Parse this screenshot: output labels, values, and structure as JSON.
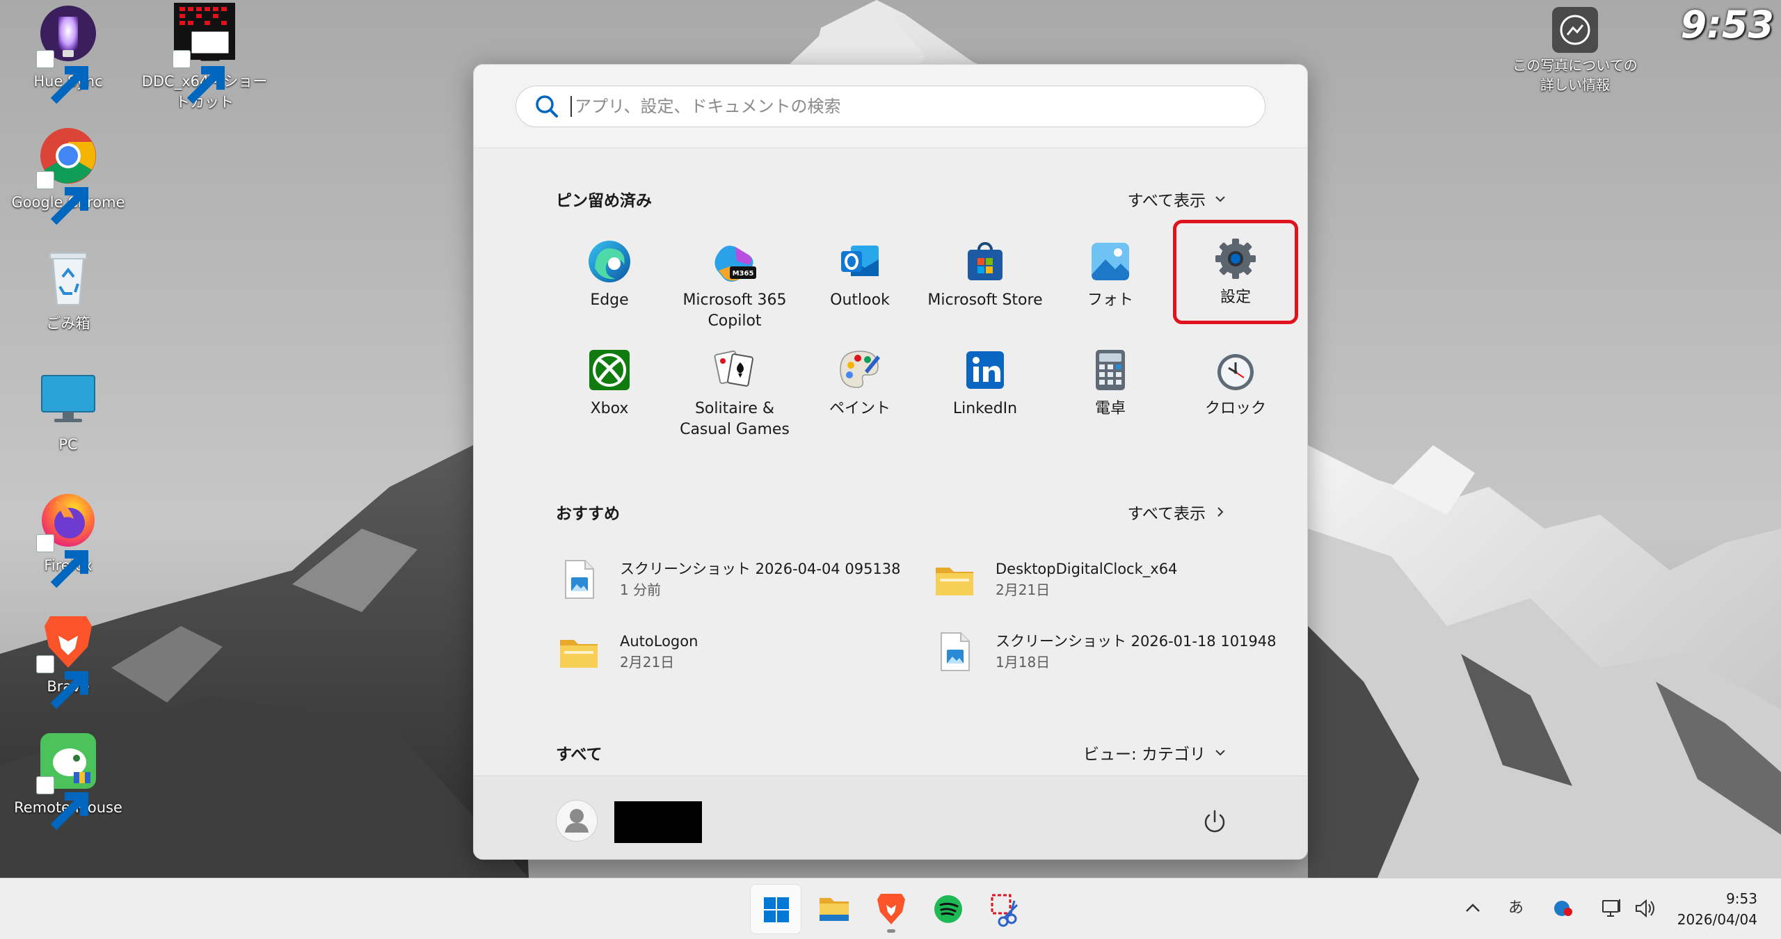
{
  "desktop": {
    "icons": [
      {
        "label": "Hue Sync"
      },
      {
        "label": "DDC_x64 - ショートカット"
      },
      {
        "label": "Google Chrome"
      },
      {
        "label": "ごみ箱"
      },
      {
        "label": "PC"
      },
      {
        "label": "Firefox"
      },
      {
        "label": "Brave"
      },
      {
        "label": "Remote Mouse"
      }
    ],
    "photo_info_label": "この写真についての詳しい情報",
    "clock_overlay": "9:53"
  },
  "start_menu": {
    "search": {
      "placeholder": "アプリ、設定、ドキュメントの検索",
      "value": ""
    },
    "pinned": {
      "title": "ピン留め済み",
      "show_all": "すべて表示",
      "apps": [
        {
          "label": "Edge",
          "icon": "edge-icon"
        },
        {
          "label": "Microsoft 365 Copilot",
          "icon": "m365-copilot-icon",
          "badge": "M365"
        },
        {
          "label": "Outlook",
          "icon": "outlook-icon"
        },
        {
          "label": "Microsoft Store",
          "icon": "microsoft-store-icon"
        },
        {
          "label": "フォト",
          "icon": "photos-icon"
        },
        {
          "label": "設定",
          "icon": "settings-gear-icon",
          "highlighted": true
        },
        {
          "label": "Xbox",
          "icon": "xbox-icon"
        },
        {
          "label": "Solitaire & Casual Games",
          "icon": "solitaire-icon"
        },
        {
          "label": "ペイント",
          "icon": "paint-icon"
        },
        {
          "label": "LinkedIn",
          "icon": "linkedin-icon"
        },
        {
          "label": "電卓",
          "icon": "calculator-icon"
        },
        {
          "label": "クロック",
          "icon": "clock-icon"
        }
      ]
    },
    "recommended": {
      "title": "おすすめ",
      "show_all": "すべて表示",
      "items": [
        {
          "name": "スクリーンショット 2026-04-04 095138",
          "time": "1 分前",
          "icon": "image-file-icon"
        },
        {
          "name": "DesktopDigitalClock_x64",
          "time": "2月21日",
          "icon": "folder-icon"
        },
        {
          "name": "AutoLogon",
          "time": "2月21日",
          "icon": "folder-icon"
        },
        {
          "name": "スクリーンショット 2026-01-18 101948",
          "time": "1月18日",
          "icon": "image-file-icon"
        }
      ]
    },
    "all_apps": {
      "title": "すべて",
      "view_label": "ビュー: カテゴリ"
    }
  },
  "taskbar": {
    "apps": [
      "start-icon",
      "file-explorer-icon",
      "brave-icon",
      "spotify-icon",
      "snipping-tool-icon"
    ],
    "tray": {
      "ime": "あ"
    },
    "clock": {
      "time": "9:53",
      "date": "2026/04/04"
    }
  },
  "colors": {
    "highlight_border": "#e0121d",
    "accent": "#0067c0"
  }
}
